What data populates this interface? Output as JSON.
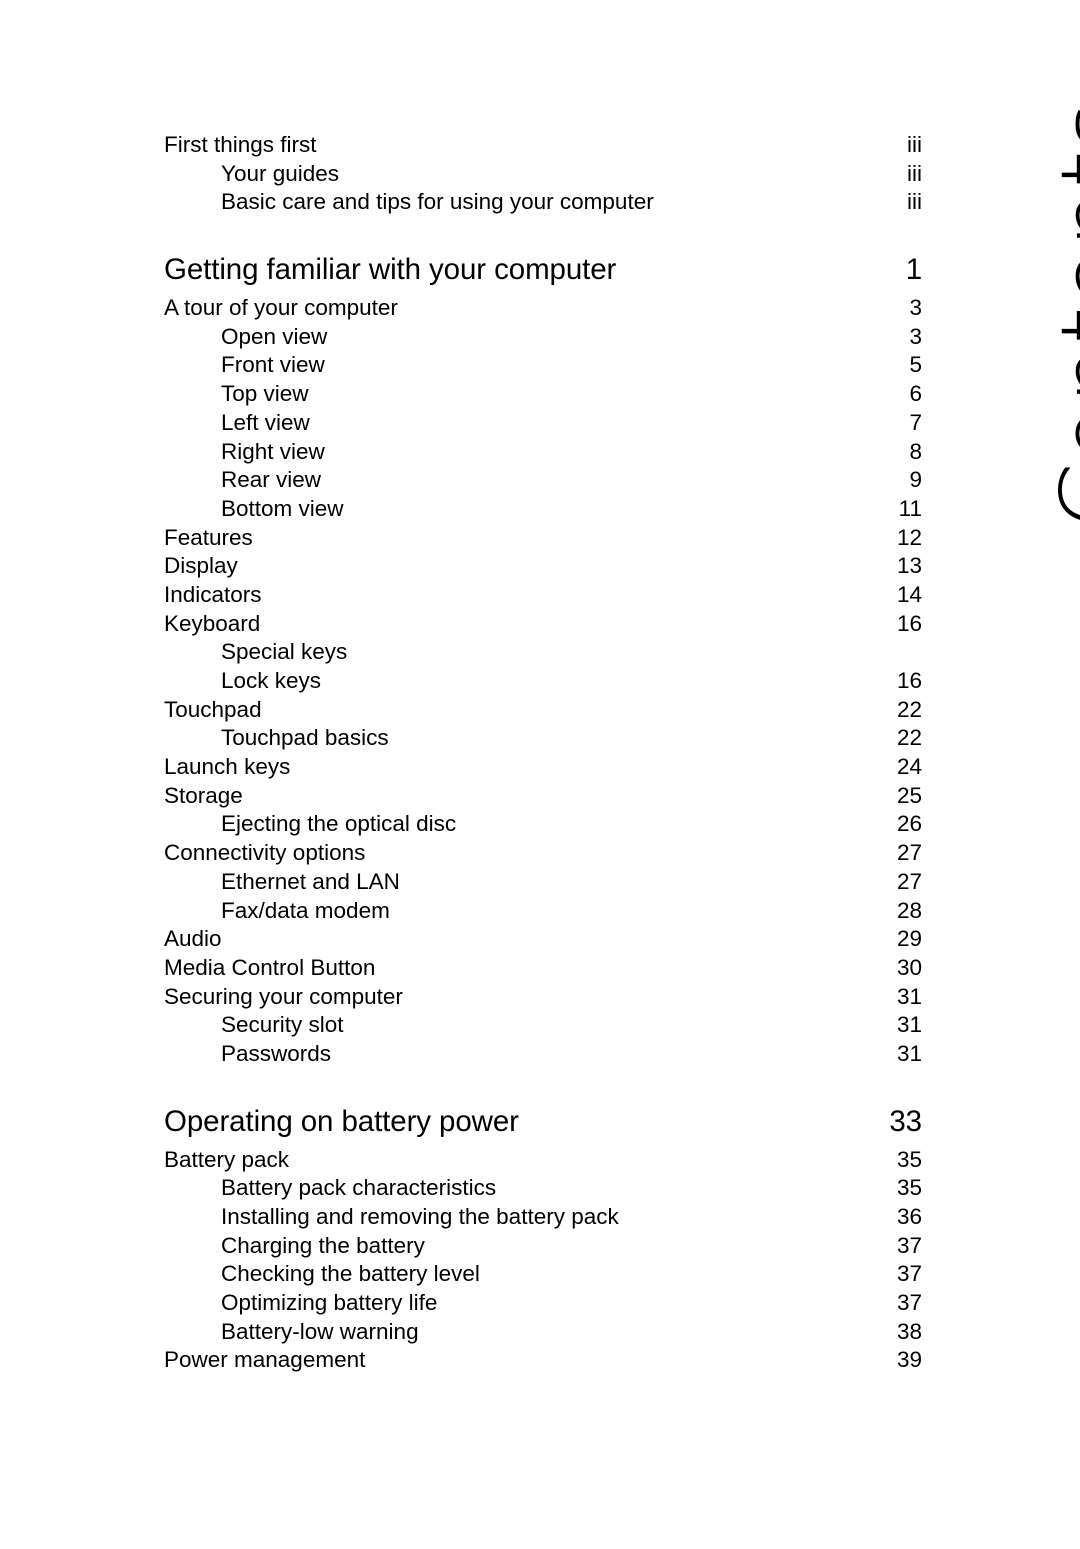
{
  "page": {
    "side_title": "Contents"
  },
  "toc": {
    "entries": [
      {
        "level": 1,
        "title": "First things first",
        "page": "iii",
        "gap_before": false
      },
      {
        "level": 2,
        "title": "Your guides",
        "page": "iii",
        "gap_before": false
      },
      {
        "level": 2,
        "title": "Basic care and tips for using your computer",
        "page": "iii",
        "gap_before": false
      },
      {
        "level": 0,
        "title": "Getting familiar with your computer",
        "page": "1",
        "gap_before": true
      },
      {
        "level": 1,
        "title": "A tour of your computer",
        "page": "3",
        "gap_before": false
      },
      {
        "level": 2,
        "title": "Open view",
        "page": "3",
        "gap_before": false
      },
      {
        "level": 2,
        "title": "Front view",
        "page": "5",
        "gap_before": false
      },
      {
        "level": 2,
        "title": "Top view",
        "page": "6",
        "gap_before": false
      },
      {
        "level": 2,
        "title": "Left view",
        "page": "7",
        "gap_before": false
      },
      {
        "level": 2,
        "title": "Right view",
        "page": "8",
        "gap_before": false
      },
      {
        "level": 2,
        "title": "Rear view",
        "page": "9",
        "gap_before": false
      },
      {
        "level": 2,
        "title": "Bottom view",
        "page": "11",
        "gap_before": false
      },
      {
        "level": 1,
        "title": "Features",
        "page": "12",
        "gap_before": false
      },
      {
        "level": 1,
        "title": "Display",
        "page": "13",
        "gap_before": false
      },
      {
        "level": 1,
        "title": "Indicators",
        "page": "14",
        "gap_before": false
      },
      {
        "level": 1,
        "title": "Keyboard",
        "page": "16",
        "gap_before": false
      },
      {
        "level": 2,
        "title": "Special keys",
        "page": "",
        "gap_before": false
      },
      {
        "level": 2,
        "title": "Lock keys",
        "page": "16",
        "gap_before": false
      },
      {
        "level": 1,
        "title": "Touchpad",
        "page": "22",
        "gap_before": false
      },
      {
        "level": 2,
        "title": "Touchpad basics",
        "page": "22",
        "gap_before": false
      },
      {
        "level": 1,
        "title": "Launch keys",
        "page": "24",
        "gap_before": false
      },
      {
        "level": 1,
        "title": "Storage",
        "page": "25",
        "gap_before": false
      },
      {
        "level": 2,
        "title": "Ejecting the optical disc",
        "page": "26",
        "gap_before": false
      },
      {
        "level": 1,
        "title": "Connectivity options",
        "page": "27",
        "gap_before": false
      },
      {
        "level": 2,
        "title": "Ethernet and LAN",
        "page": "27",
        "gap_before": false
      },
      {
        "level": 2,
        "title": "Fax/data modem",
        "page": "28",
        "gap_before": false
      },
      {
        "level": 1,
        "title": "Audio",
        "page": "29",
        "gap_before": false
      },
      {
        "level": 1,
        "title": "Media Control Button",
        "page": "30",
        "gap_before": false
      },
      {
        "level": 1,
        "title": "Securing your computer",
        "page": "31",
        "gap_before": false
      },
      {
        "level": 2,
        "title": "Security slot",
        "page": "31",
        "gap_before": false
      },
      {
        "level": 2,
        "title": "Passwords",
        "page": "31",
        "gap_before": false
      },
      {
        "level": 0,
        "title": "Operating on battery power",
        "page": "33",
        "gap_before": true
      },
      {
        "level": 1,
        "title": "Battery pack",
        "page": "35",
        "gap_before": false
      },
      {
        "level": 2,
        "title": "Battery pack characteristics",
        "page": "35",
        "gap_before": false
      },
      {
        "level": 2,
        "title": "Installing and removing the battery pack",
        "page": "36",
        "gap_before": false
      },
      {
        "level": 2,
        "title": "Charging the battery",
        "page": "37",
        "gap_before": false
      },
      {
        "level": 2,
        "title": "Checking the battery level",
        "page": "37",
        "gap_before": false
      },
      {
        "level": 2,
        "title": "Optimizing battery life",
        "page": "37",
        "gap_before": false
      },
      {
        "level": 2,
        "title": "Battery-low warning",
        "page": "38",
        "gap_before": false
      },
      {
        "level": 1,
        "title": "Power management",
        "page": "39",
        "gap_before": false
      }
    ]
  }
}
